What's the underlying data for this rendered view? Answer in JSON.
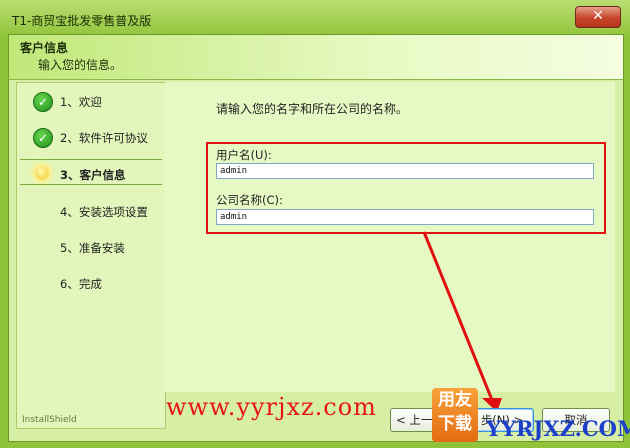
{
  "window": {
    "title": "T1-商贸宝批发零售普及版",
    "close_glyph": "✕"
  },
  "header": {
    "title": "客户信息",
    "subtitle": "输入您的信息。"
  },
  "steps": [
    {
      "label": "1、欢迎",
      "state": "done"
    },
    {
      "label": "2、软件许可协议",
      "state": "done"
    },
    {
      "label": "3、客户信息",
      "state": "current"
    },
    {
      "label": "4、安装选项设置",
      "state": "pending"
    },
    {
      "label": "5、准备安装",
      "state": "pending"
    },
    {
      "label": "6、完成",
      "state": "pending"
    }
  ],
  "step_icons": {
    "done": "✓"
  },
  "brand_footer": "InstallShield",
  "form": {
    "prompt": "请输入您的名字和所在公司的名称。",
    "username_label": "用户名(U):",
    "username_value": "admin",
    "company_label": "公司名称(C):",
    "company_value": "admin"
  },
  "buttons": {
    "back": "< 上一步",
    "next": "步(N) >",
    "cancel": "取消"
  },
  "watermark": {
    "url": "www.yyrjxz.com",
    "logo_text_top": "用友",
    "logo_text_bottom": "下载",
    "logo_url": "YYRJXZ.COM"
  },
  "colors": {
    "highlight": "#e01010",
    "accent": "#8fc33a"
  }
}
